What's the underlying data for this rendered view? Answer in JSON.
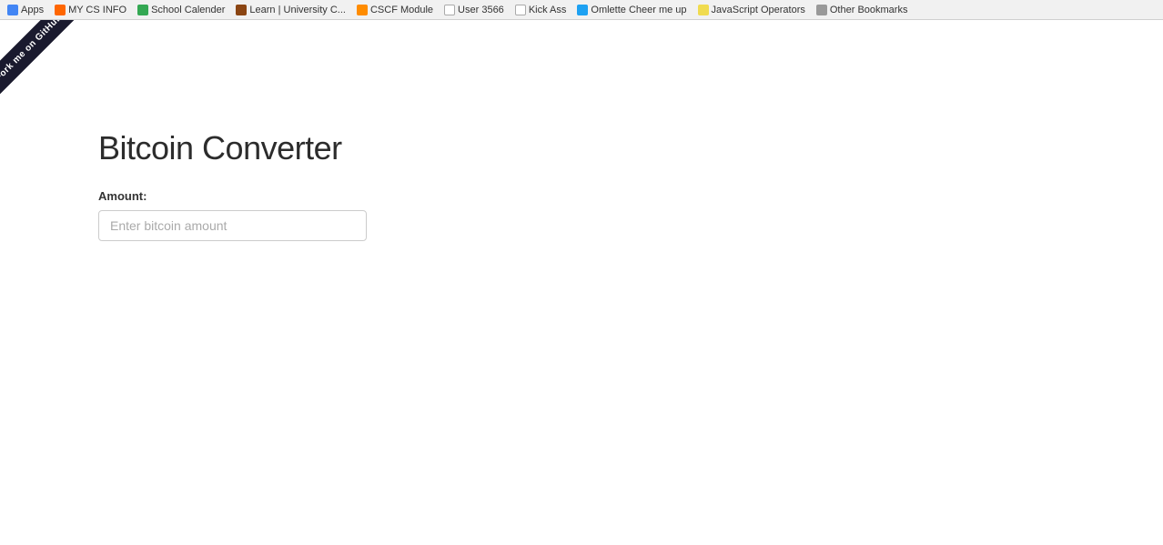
{
  "bookmarks": {
    "items": [
      {
        "label": "Apps",
        "icon_type": "apps"
      },
      {
        "label": "MY CS INFO",
        "icon_type": "my-cs"
      },
      {
        "label": "School Calender",
        "icon_type": "school"
      },
      {
        "label": "Learn | University C...",
        "icon_type": "learn"
      },
      {
        "label": "CSCF Module",
        "icon_type": "cscf"
      },
      {
        "label": "User 3566",
        "icon_type": "user"
      },
      {
        "label": "Kick Ass",
        "icon_type": "kick"
      },
      {
        "label": "Omlette Cheer me up",
        "icon_type": "omlette"
      },
      {
        "label": "JavaScript Operators",
        "icon_type": "js"
      },
      {
        "label": "Other Bookmarks",
        "icon_type": "other"
      }
    ]
  },
  "ribbon": {
    "line1": "Fork me on GitHub"
  },
  "main": {
    "title": "Bitcoin Converter",
    "amount_label": "Amount:",
    "input_placeholder": "Enter bitcoin amount"
  }
}
